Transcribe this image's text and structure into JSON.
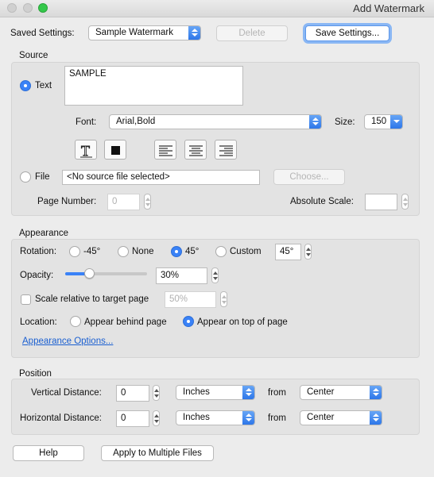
{
  "window": {
    "title": "Add Watermark"
  },
  "saved_settings": {
    "label": "Saved Settings:",
    "value": "Sample Watermark",
    "delete_label": "Delete",
    "save_label": "Save Settings..."
  },
  "source": {
    "title": "Source",
    "text_label": "Text",
    "text_value": "SAMPLE",
    "font_label": "Font:",
    "font_value": "Arial,Bold",
    "size_label": "Size:",
    "size_value": "150",
    "file_label": "File",
    "file_value": "<No source file selected>",
    "choose_label": "Choose...",
    "page_number_label": "Page Number:",
    "page_number_value": "0",
    "absolute_scale_label": "Absolute Scale:",
    "absolute_scale_value": ""
  },
  "appearance": {
    "title": "Appearance",
    "rotation_label": "Rotation:",
    "rot_minus45": "-45°",
    "rot_none": "None",
    "rot_45": "45°",
    "rot_custom": "Custom",
    "custom_value": "45°",
    "opacity_label": "Opacity:",
    "opacity_value": "30%",
    "opacity_fraction": 0.3,
    "scale_label": "Scale relative to target page",
    "scale_value": "50%",
    "location_label": "Location:",
    "behind_label": "Appear behind page",
    "on_top_label": "Appear on top of page",
    "options_link": "Appearance Options..."
  },
  "position": {
    "title": "Position",
    "vertical_label": "Vertical Distance:",
    "vertical_value": "0",
    "vertical_unit": "Inches",
    "vertical_from": "from",
    "vertical_anchor": "Center",
    "horizontal_label": "Horizontal Distance:",
    "horizontal_value": "0",
    "horizontal_unit": "Inches",
    "horizontal_from": "from",
    "horizontal_anchor": "Center"
  },
  "footer": {
    "help_label": "Help",
    "apply_label": "Apply to Multiple Files"
  },
  "colors": {
    "accent": "#3a82f7",
    "close": "#fc605c",
    "minimize": "#fdbc40",
    "zoom": "#34c84a"
  }
}
